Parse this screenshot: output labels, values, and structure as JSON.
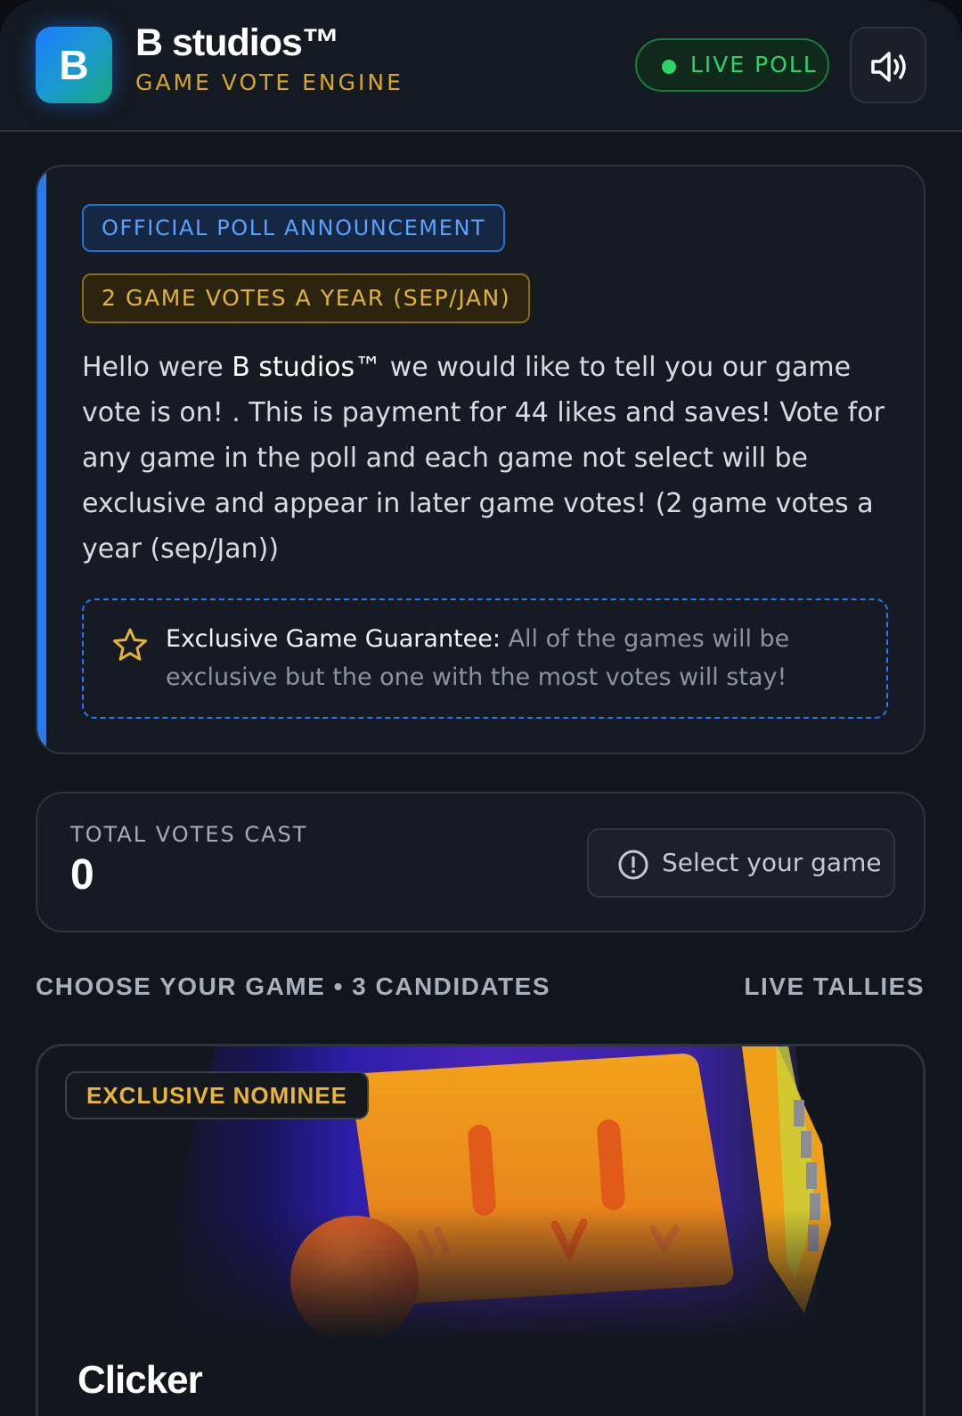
{
  "header": {
    "logo_letter": "B",
    "title": "B studios™",
    "subtitle": "GAME VOTE ENGINE",
    "live_label": "LIVE POLL",
    "sound_icon": "speaker-icon"
  },
  "announcement": {
    "tag_primary": "OFFICIAL POLL ANNOUNCEMENT",
    "tag_secondary": "2 GAME VOTES A YEAR (SEP/JAN)",
    "body_before": "Hello were ",
    "body_brand": "B studios™",
    "body_after": " we would like to tell you our game vote is on! . This is payment for 44 likes and saves! Vote for any game in the poll and each game not select will be exclusive and appear in later game votes! (2 game votes a year (sep/Jan))",
    "guarantee_label": "Exclusive Game Guarantee:",
    "guarantee_text": " All of the games will be exclusive but the one with the most votes will stay!",
    "guarantee_icon": "star-icon"
  },
  "votes": {
    "label": "TOTAL VOTES CAST",
    "value": "0",
    "select_label": "Select your game",
    "select_icon": "alert-circle-icon"
  },
  "section": {
    "left": "CHOOSE YOUR GAME • 3 CANDIDATES",
    "right": "LIVE TALLIES"
  },
  "games": [
    {
      "badge": "EXCLUSIVE NOMINEE",
      "title": "Clicker"
    }
  ],
  "colors": {
    "accent_blue": "#2a78f0",
    "accent_gold": "#e3b23c",
    "live_green": "#2fd36a",
    "background": "#11151c"
  }
}
